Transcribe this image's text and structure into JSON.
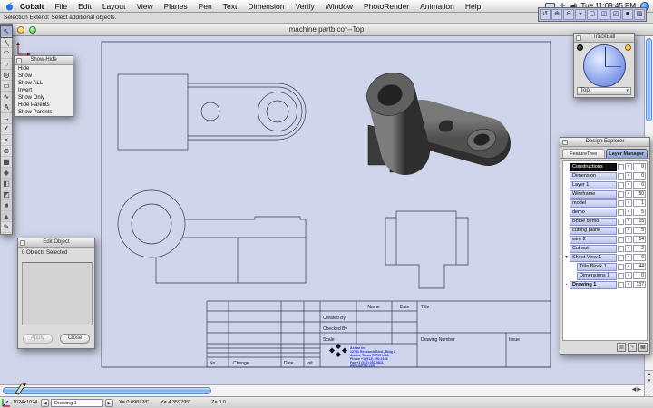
{
  "menubar": {
    "items": [
      {
        "label": "Cobalt",
        "bold": true
      },
      {
        "label": "File"
      },
      {
        "label": "Edit"
      },
      {
        "label": "Layout"
      },
      {
        "label": "View"
      },
      {
        "label": "Planes"
      },
      {
        "label": "Pen"
      },
      {
        "label": "Text"
      },
      {
        "label": "Dimension"
      },
      {
        "label": "Verify"
      },
      {
        "label": "Window"
      },
      {
        "label": "PhotoRender"
      },
      {
        "label": "Animation"
      },
      {
        "label": "Help"
      }
    ],
    "clock": "Tue 11:09:45 PM"
  },
  "message_line": "Selection Extend: Select additional objects.",
  "window": {
    "title": "machine partb.co*--Top"
  },
  "left_toolbar": {
    "tools": [
      {
        "glyph": "↖",
        "dn": "tool-select-icon",
        "sel": true
      },
      {
        "glyph": "╲",
        "dn": "tool-line-icon"
      },
      {
        "glyph": "◠",
        "dn": "tool-arc-icon"
      },
      {
        "glyph": "○",
        "dn": "tool-circle-icon"
      },
      {
        "glyph": "◎",
        "dn": "tool-ellipse-icon"
      },
      {
        "glyph": "▭",
        "dn": "tool-rectangle-icon"
      },
      {
        "glyph": "∿",
        "dn": "tool-spline-icon"
      },
      {
        "glyph": "A",
        "dn": "tool-text-icon"
      },
      {
        "glyph": "↔",
        "dn": "tool-dimension-icon"
      },
      {
        "glyph": "∠",
        "dn": "tool-angle-dimension-icon"
      },
      {
        "glyph": "×",
        "dn": "tool-trim-icon"
      },
      {
        "glyph": "⊕",
        "dn": "tool-point-icon"
      },
      {
        "glyph": "▦",
        "dn": "tool-hatch-icon"
      },
      {
        "glyph": "◆",
        "dn": "tool-extrude-solid-icon",
        "g3d": true
      },
      {
        "glyph": "◧",
        "dn": "tool-revolve-solid-icon",
        "g3d": true
      },
      {
        "glyph": "◩",
        "dn": "tool-sweep-solid-icon",
        "g3d": true
      },
      {
        "glyph": "■",
        "dn": "tool-boolean-solid-icon",
        "g3d": true
      },
      {
        "glyph": "▲",
        "dn": "tool-shell-solid-icon",
        "g3d": true
      },
      {
        "glyph": "✎",
        "dn": "tool-annotate-icon"
      }
    ]
  },
  "mini_toolbar": {
    "buttons": [
      {
        "glyph": "↺",
        "dn": "rotate-view-icon"
      },
      {
        "glyph": "⊕",
        "dn": "zoom-in-icon"
      },
      {
        "glyph": "⊖",
        "dn": "zoom-out-icon"
      },
      {
        "glyph": "⌖",
        "dn": "zoom-window-icon"
      },
      {
        "glyph": "▢",
        "dn": "zoom-all-icon"
      },
      {
        "glyph": "◫",
        "dn": "pan-view-icon"
      },
      {
        "glyph": "◰",
        "dn": "view-corner-icon"
      },
      {
        "glyph": "■",
        "dn": "shaded-view-icon"
      },
      {
        "glyph": "▨",
        "dn": "wireframe-view-icon"
      }
    ]
  },
  "show_hide": {
    "title": "Show-Hide",
    "items": [
      {
        "label": "Hide"
      },
      {
        "label": "Show"
      },
      {
        "label": "Show ALL"
      },
      {
        "label": "Invert"
      },
      {
        "label": "Show Only"
      },
      {
        "label": "Hide Parents"
      },
      {
        "label": "Show Parents"
      }
    ]
  },
  "edit_object": {
    "title": "Edit Object",
    "status": "0 Objects Selected",
    "apply": "Apply",
    "close": "Close"
  },
  "trackball": {
    "title": "TrackBall",
    "view": "Top",
    "arrow": "▾"
  },
  "design_explorer": {
    "title": "Design Explorer",
    "tabs": [
      {
        "label": "FeatureTree"
      },
      {
        "label": "Layer Manager",
        "active": true
      }
    ],
    "rows": [
      {
        "label": "Constructions",
        "count": "0",
        "sel": true
      },
      {
        "label": "Dimension",
        "count": "0"
      },
      {
        "label": "Layer 1",
        "count": "0"
      },
      {
        "label": "Wireframe",
        "count": "50"
      },
      {
        "label": "model",
        "count": "1"
      },
      {
        "label": "demo",
        "count": "5"
      },
      {
        "label": "Bottle demo",
        "count": "15"
      },
      {
        "label": "cutting plane",
        "count": "5"
      },
      {
        "label": "wire 2",
        "count": "14"
      },
      {
        "label": "Cut out",
        "count": "2"
      },
      {
        "label": "Sheet View 1",
        "count": "0",
        "lead": "▼"
      },
      {
        "label": "Title Block 1",
        "count": "44",
        "indent": 8
      },
      {
        "label": "Dimensions 1",
        "count": "0",
        "indent": 8
      },
      {
        "label": "Drawing 1",
        "count": "137",
        "bold": true,
        "lead": "▪",
        "leadred": true
      }
    ],
    "buttons": [
      {
        "glyph": "▤",
        "dn": "new-layer-icon"
      },
      {
        "glyph": "✎",
        "dn": "edit-layer-icon"
      },
      {
        "glyph": "▦",
        "dn": "delete-layer-icon"
      }
    ]
  },
  "title_block": {
    "name_header": "Name",
    "date_header": "Date",
    "created_by": "Created By",
    "checked_by": "Checked By",
    "scale": "Scale",
    "title": "Title",
    "drawing_number": "Drawing Number",
    "issue": "Issue",
    "no": "No",
    "change": "Change",
    "date_col": "Date",
    "init": "Init",
    "company": [
      "Ashlar  Inc",
      "12731 Research Blvd., Bldg A",
      "Austin, Texas 78759 USA",
      "Phone +1 (512) 250-2186",
      "Fax +1 (512) 250-5811",
      "www.ashlar.com"
    ]
  },
  "status_bar": {
    "zoom": "1024x1024",
    "sheet": "Drawing 1",
    "left_arrow": "◀",
    "right_arrow": "▶",
    "x_label": "X=",
    "x_value": "0.098728\"",
    "y_label": "Y=",
    "y_value": "4.359295\"",
    "z_label": "Z=",
    "z_value": "0.0"
  }
}
